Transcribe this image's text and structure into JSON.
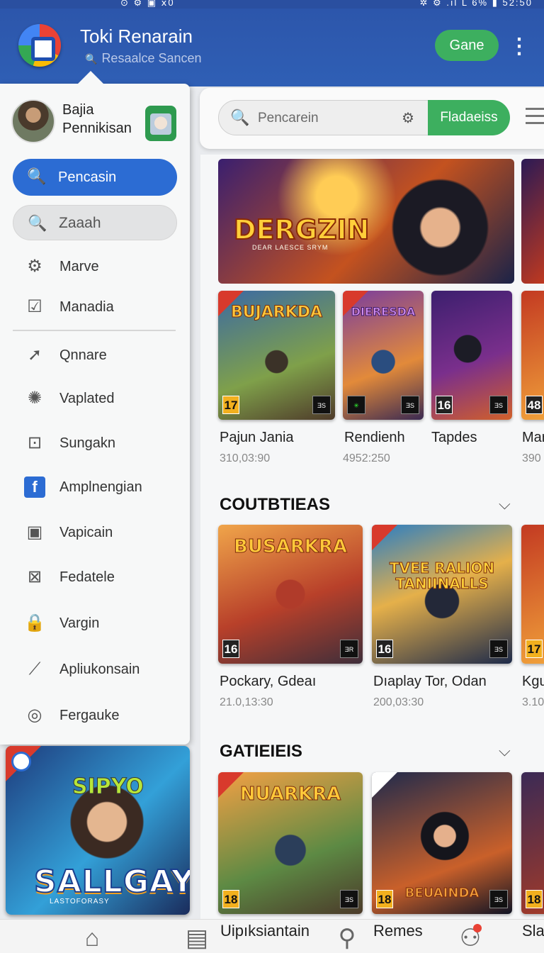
{
  "status_bar": {
    "left": "⊙ ⚙ ▣ ⅹ0",
    "right": "✲ ⚙ .ıl L 6% ▮ 52:50"
  },
  "app_bar": {
    "title": "Toki Renarain",
    "subtitle": "Resaalce Sancen",
    "game_button": "Gane"
  },
  "search": {
    "placeholder": "Pencarein",
    "filter_button": "Fladaeiss"
  },
  "drawer": {
    "user_name": "Bajia Pennikisan",
    "primary_pill": "Pencasin",
    "secondary_pill": "Zaaah",
    "items": [
      {
        "label": "Marve",
        "icon": "gear-icon"
      },
      {
        "label": "Manadia",
        "icon": "checkbox-icon"
      },
      {
        "label": "Qnnare",
        "icon": "arrow-icon"
      },
      {
        "label": "Vaplated",
        "icon": "settings-icon"
      },
      {
        "label": "Sungakn",
        "icon": "box-icon"
      },
      {
        "label": "Amplnengian",
        "icon": "facebook-icon"
      },
      {
        "label": "Vapicain",
        "icon": "square-icon"
      },
      {
        "label": "Fedatele",
        "icon": "x-box-icon"
      },
      {
        "label": "Vargin",
        "icon": "lock-icon"
      },
      {
        "label": "Apliukonsain",
        "icon": "link-icon"
      },
      {
        "label": "Fergauke",
        "icon": "target-icon"
      }
    ],
    "promo": {
      "top_text": "SIPYO",
      "title": "SALLGAY",
      "subtitle": "LASTOFORASY"
    }
  },
  "hero": {
    "title": "DERGZIN",
    "subtitle": "DEAR LAESCE SRYM"
  },
  "row1": [
    {
      "art": "BUJARKDA",
      "age": "17",
      "name": "Pajun Jania",
      "value": "310,03:90"
    },
    {
      "art": "DIERESDA",
      "age": "",
      "name": "Rendienh",
      "value": "4952:250"
    },
    {
      "art": "",
      "age": "16",
      "name": "Tapdes",
      "value": ""
    },
    {
      "art": "",
      "age": "48",
      "name": "Mar",
      "value": "390"
    }
  ],
  "section1": {
    "title": "COUTBTIEAS"
  },
  "row2": [
    {
      "art": "BUSARKRA",
      "age": "16",
      "name": "Pockary, Gdeaı",
      "value": "21.0,13:30"
    },
    {
      "art": "TVEE RALION TANIINALLS",
      "age": "16",
      "name": "Dıaplay Tor, Odan",
      "value": "200,03:30"
    },
    {
      "art": "",
      "age": "17",
      "name": "Kgu",
      "value": "3.10"
    }
  ],
  "section2": {
    "title": "GATIEIEIS"
  },
  "row3": [
    {
      "art": "NUARKRA",
      "age": "18"
    },
    {
      "art": "BEUAINDA",
      "age": "18"
    },
    {
      "art": "",
      "age": "18"
    }
  ],
  "bottom_nav": [
    {
      "label": "",
      "icon": "home-icon"
    },
    {
      "label": "Uipıksiantain",
      "icon": "book-icon"
    },
    {
      "label": "Remes",
      "icon": "person-icon"
    },
    {
      "label": "Sla",
      "icon": "people-icon"
    }
  ]
}
